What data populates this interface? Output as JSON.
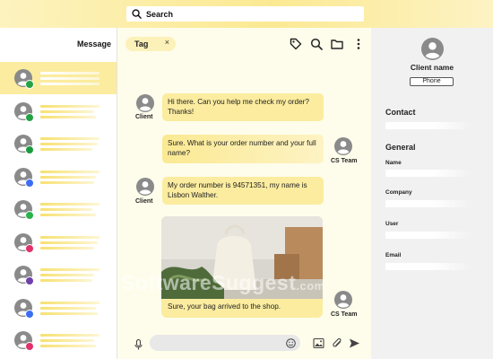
{
  "search": {
    "label": "Search"
  },
  "sidebar": {
    "title": "Message",
    "conversations": [
      {
        "channel": "whatsapp",
        "color": "#25a244",
        "active": true
      },
      {
        "channel": "whatsapp",
        "color": "#25a244",
        "active": false
      },
      {
        "channel": "whatsapp-business",
        "color": "#1a9c3e",
        "active": false
      },
      {
        "channel": "messenger",
        "color": "#3b6ef5",
        "active": false
      },
      {
        "channel": "wechat",
        "color": "#29b34a",
        "active": false
      },
      {
        "channel": "instagram",
        "color": "#e1306c",
        "active": false
      },
      {
        "channel": "viber",
        "color": "#6f3faa",
        "active": false
      },
      {
        "channel": "messenger",
        "color": "#3b6ef5",
        "active": false
      },
      {
        "channel": "instagram",
        "color": "#e1306c",
        "active": false
      }
    ]
  },
  "chat": {
    "tag": {
      "label": "Tag",
      "close": "×"
    },
    "messages": [
      {
        "from": "Client",
        "text": "Hi there. Can you help me check my order? Thanks!"
      },
      {
        "from": "CS Team",
        "text": "Sure. What is your order number and your full name?"
      },
      {
        "from": "Client",
        "text": "My order number is 94571351, my name is Lisbon Walther."
      },
      {
        "from": "CS Team",
        "text": "Sure, your bag arrived to the shop."
      }
    ],
    "composer": {
      "placeholder": ""
    }
  },
  "panel": {
    "client_name": "Client name",
    "phone_label": "Phone",
    "contact_title": "Contact",
    "general_title": "General",
    "fields": [
      "Name",
      "Company",
      "User",
      "Email"
    ]
  },
  "watermark": {
    "main": "SoftwareSuggest",
    "suffix": ".com"
  },
  "colors": {
    "accent": "#fbec9f",
    "panel": "#f1f1f1",
    "chat_bg": "#fefdeb"
  }
}
